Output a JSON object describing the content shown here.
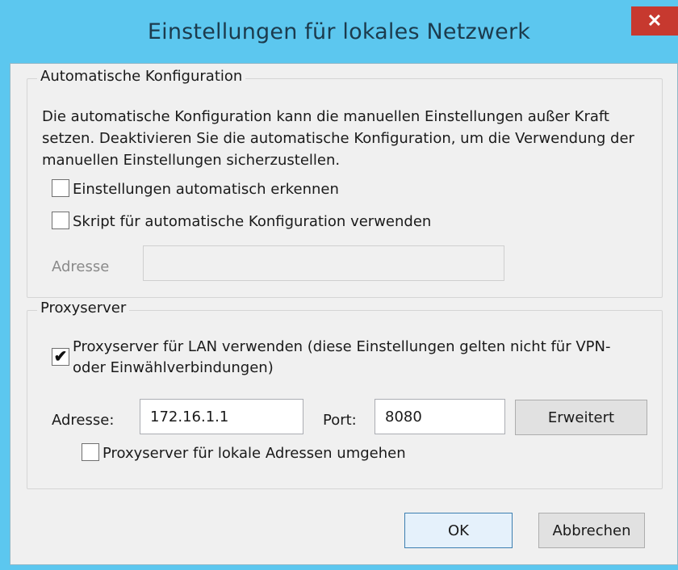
{
  "dialog": {
    "title": "Einstellungen für lokales Netzwerk",
    "close_glyph": "✕"
  },
  "auto_config": {
    "group_title": "Automatische Konfiguration",
    "description": "Die automatische Konfiguration kann die manuellen Einstellungen außer Kraft setzen. Deaktivieren Sie die automatische Konfiguration, um die Verwendung der manuellen Einstellungen sicherzustellen.",
    "detect_label": "Einstellungen automatisch erkennen",
    "detect_checked": false,
    "script_label": "Skript für automatische Konfiguration verwenden",
    "script_checked": false,
    "address_label": "Adresse",
    "address_value": ""
  },
  "proxy": {
    "group_title": "Proxyserver",
    "use_proxy_label": "Proxyserver für LAN verwenden (diese Einstellungen gelten nicht für VPN- oder Einwählverbindungen)",
    "use_proxy_checked": true,
    "address_label": "Adresse:",
    "address_value": "172.16.1.1",
    "port_label": "Port:",
    "port_value": "8080",
    "advanced_label": "Erweitert",
    "bypass_label": "Proxyserver für lokale Adressen umgehen",
    "bypass_checked": false
  },
  "buttons": {
    "ok": "OK",
    "cancel": "Abbrechen"
  },
  "checkmark_glyph": "✔",
  "colors": {
    "title_bar": "#5cc7ef",
    "close_button": "#c7392f",
    "client_bg": "#f0f0f0"
  }
}
